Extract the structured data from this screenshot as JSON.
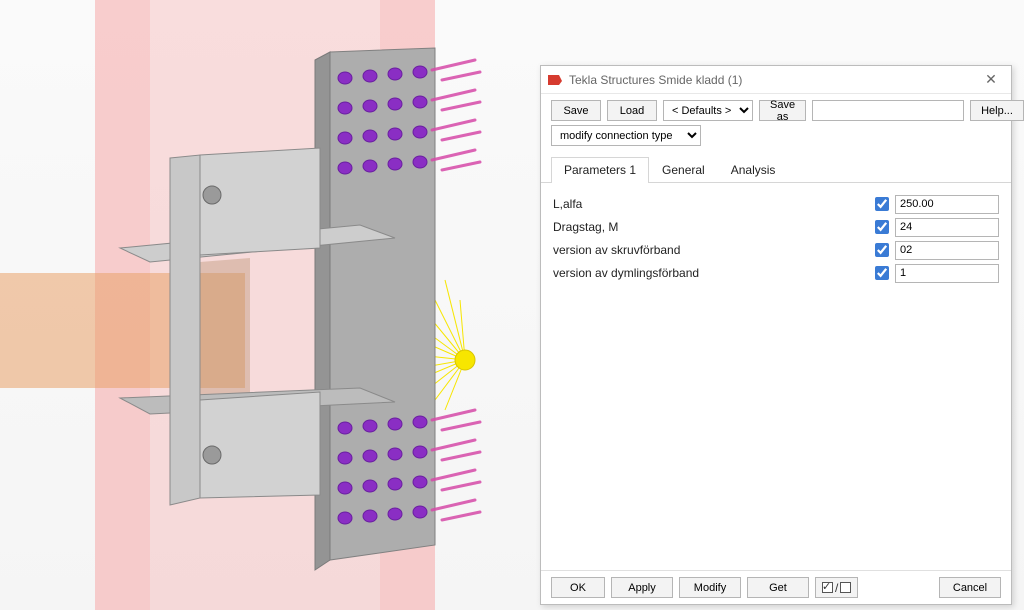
{
  "dialog": {
    "title": "Tekla Structures  Smide kladd (1)",
    "toolbar": {
      "save": "Save",
      "load": "Load",
      "preset": "< Defaults >",
      "save_as": "Save as",
      "help": "Help...",
      "modify_conn": "modify connection type"
    },
    "tabs": {
      "parameters": "Parameters 1",
      "general": "General",
      "analysis": "Analysis"
    },
    "params": [
      {
        "label": "L,alfa",
        "checked": true,
        "value": "250.00"
      },
      {
        "label": "Dragstag, M",
        "checked": true,
        "value": "24"
      },
      {
        "label": "version av skruvförband",
        "checked": true,
        "value": "02"
      },
      {
        "label": "version av dymlingsförband",
        "checked": true,
        "value": "1"
      }
    ],
    "footer": {
      "ok": "OK",
      "apply": "Apply",
      "modify": "Modify",
      "get": "Get",
      "cancel": "Cancel"
    }
  }
}
